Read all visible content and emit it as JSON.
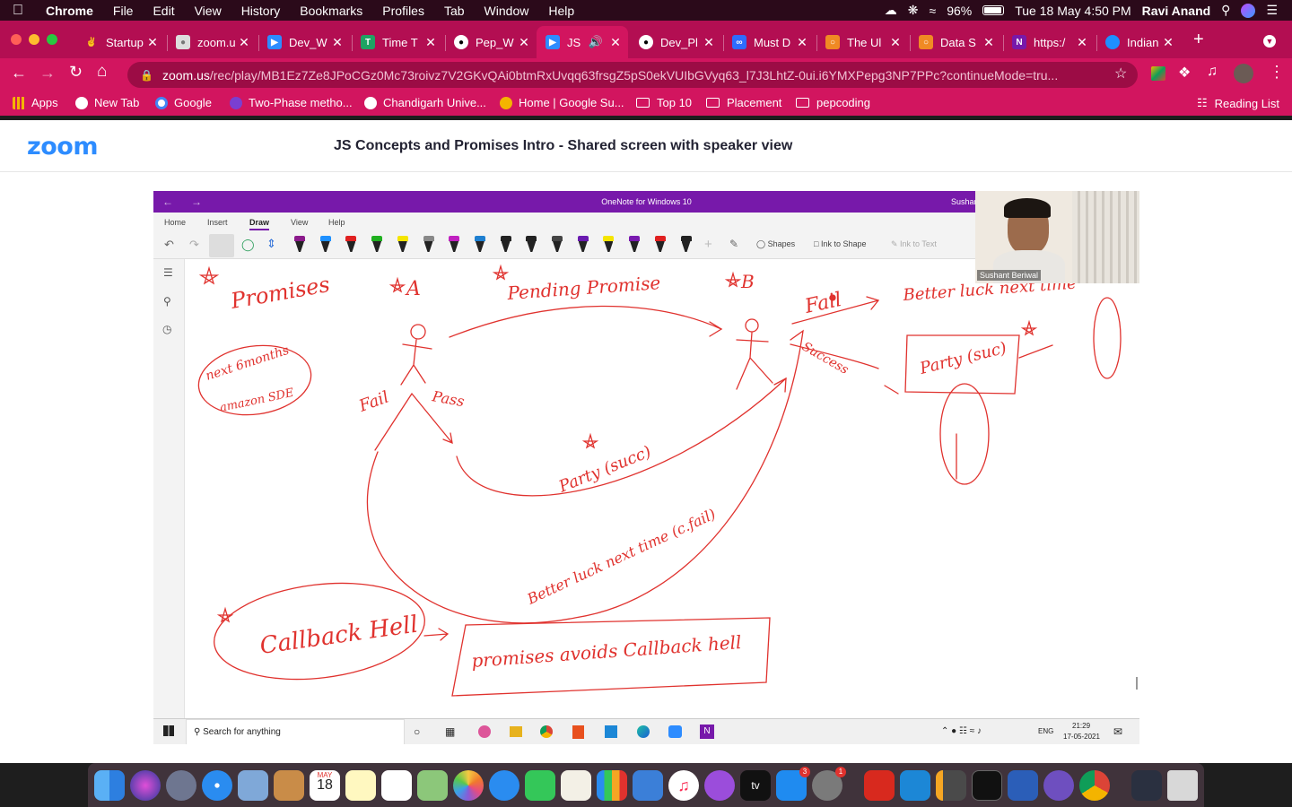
{
  "menubar": {
    "app": "Chrome",
    "items": [
      "File",
      "Edit",
      "View",
      "History",
      "Bookmarks",
      "Profiles",
      "Tab",
      "Window",
      "Help"
    ],
    "battery": "96%",
    "datetime": "Tue 18 May  4:50 PM",
    "user": "Ravi Anand"
  },
  "tabs": [
    {
      "title": "Startup",
      "icon": "startup-icon"
    },
    {
      "title": "zoom.u",
      "icon": "zoom-icon"
    },
    {
      "title": "Dev_W",
      "icon": "zoom-icon"
    },
    {
      "title": "Time T",
      "icon": "sheets-icon"
    },
    {
      "title": "Pep_W",
      "icon": "github-icon"
    },
    {
      "title": "JS",
      "icon": "zoom-icon",
      "active": true
    },
    {
      "title": "Dev_Pl",
      "icon": "github-icon"
    },
    {
      "title": "Must D",
      "icon": "infinity-icon"
    },
    {
      "title": "The Ul",
      "icon": "codechef-icon"
    },
    {
      "title": "Data S",
      "icon": "codechef-icon"
    },
    {
      "title": "https:/",
      "icon": "onenote-icon"
    },
    {
      "title": "Indian",
      "icon": "globe-icon"
    }
  ],
  "address": {
    "host": "zoom.us",
    "path": "/rec/play/MB1Ez7Ze8JPoCGz0Mc73roivz7V2GKvQAi0btmRxUvqq63frsgZ5pS0ekVUIbGVyq63_l7J3LhtZ-0ui.i6YMXPepg3NP7PPc?continueMode=tru..."
  },
  "bookmarks": [
    {
      "label": "Apps",
      "icon": "apps-grid-icon"
    },
    {
      "label": "New Tab",
      "icon": "globe-icon"
    },
    {
      "label": "Google",
      "icon": "google-icon"
    },
    {
      "label": "Two-Phase metho...",
      "icon": "bookmark-icon"
    },
    {
      "label": "Chandigarh Unive...",
      "icon": "globe-icon"
    },
    {
      "label": "Home | Google Su...",
      "icon": "sun-icon"
    },
    {
      "label": "Top 10",
      "icon": "folder-icon"
    },
    {
      "label": "Placement",
      "icon": "folder-icon"
    },
    {
      "label": "pepcoding",
      "icon": "folder-icon"
    }
  ],
  "reading_list": "Reading List",
  "zoom": {
    "logo": "zoom",
    "title": "JS Concepts and Promises Intro - Shared screen with speaker view"
  },
  "onenote": {
    "window_title": "OneNote for Windows 10",
    "user_partial": "Sushar",
    "ribbon_tabs": [
      "Home",
      "Insert",
      "Draw",
      "View",
      "Help"
    ],
    "active_tab": "Draw",
    "tools": {
      "shapes": "Shapes",
      "ink_to_shape": "Ink to Shape",
      "ink_to_text": "Ink to Text"
    },
    "pen_colors": [
      "#8b1a8b",
      "#1e90ff",
      "#e02020",
      "#20b020",
      "#f5e500",
      "#888888",
      "#c020c0",
      "#1e7fd0",
      "#222222",
      "#222222",
      "#444444",
      "#6a1ab0",
      "#f5e500",
      "#7a1ab0",
      "#e02020",
      "#222222"
    ],
    "speaker_name": "Sushant Beriwal",
    "ink": {
      "promises": "Promises",
      "next6": "next 6months",
      "amazon": "amazon SDE",
      "a": "A",
      "b": "B",
      "pending": "Pending Promise",
      "fail_left": "Fail",
      "pass": "Pass",
      "party_succ": "Party (succ)",
      "betterluck_bottom": "Better luck next time (c.fail)",
      "fail_right": "Fail",
      "success": "Success",
      "betterluck_top": "Better luck next time",
      "party_right": "Party (suc)",
      "callback_hell": "Callback Hell",
      "avoids": "promises avoids Callback hell"
    }
  },
  "windows_taskbar": {
    "search": "Search for anything",
    "lang": "ENG",
    "time": "21:29",
    "date": "17-05-2021"
  },
  "dock": {
    "calendar_month": "MAY",
    "calendar_day": "18",
    "tv_label": "tv",
    "badge_appstore": "3",
    "badge_settings": "1"
  }
}
